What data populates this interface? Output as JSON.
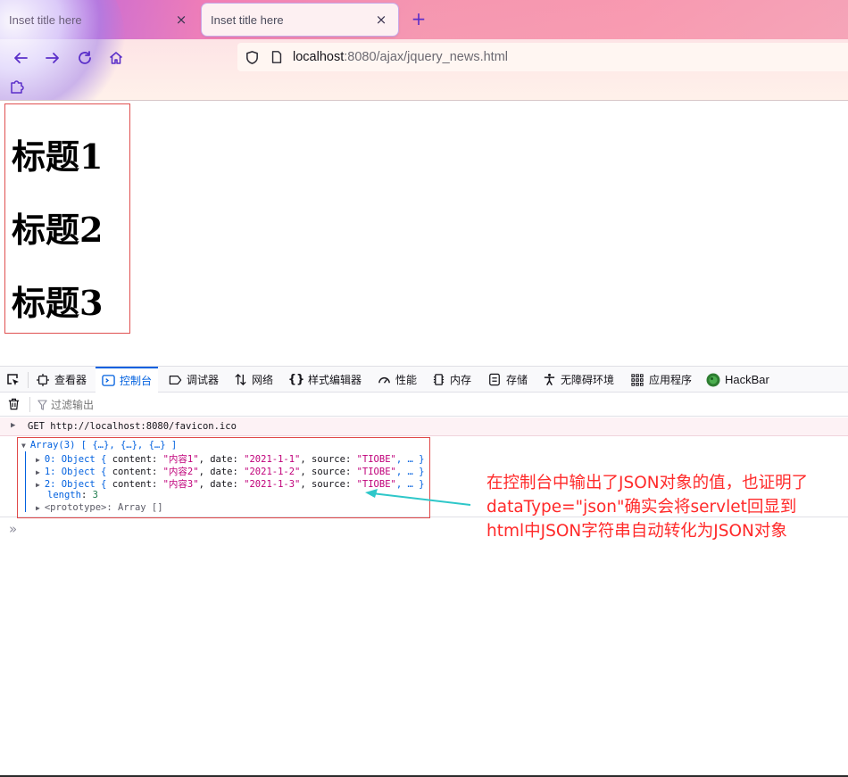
{
  "browser": {
    "tabs": [
      {
        "title": "Inset title here",
        "close_glyph": "×"
      },
      {
        "title": "Inset title here",
        "close_glyph": "×"
      }
    ],
    "new_tab_glyph": "+",
    "url_host": "localhost",
    "url_rest": ":8080/ajax/jquery_news.html",
    "accent_color": "#5b2fc9"
  },
  "page": {
    "headings": [
      "标题1",
      "标题2",
      "标题3"
    ]
  },
  "devtools": {
    "tabs": [
      {
        "label": "查看器",
        "icon": "inspector-icon"
      },
      {
        "label": "控制台",
        "icon": "console-icon"
      },
      {
        "label": "调试器",
        "icon": "debugger-icon"
      },
      {
        "label": "网络",
        "icon": "network-icon"
      },
      {
        "label": "样式编辑器",
        "icon": "style-editor-icon"
      },
      {
        "label": "性能",
        "icon": "performance-icon"
      },
      {
        "label": "内存",
        "icon": "memory-icon"
      },
      {
        "label": "存储",
        "icon": "storage-icon"
      },
      {
        "label": "无障碍环境",
        "icon": "accessibility-icon"
      },
      {
        "label": "应用程序",
        "icon": "application-icon"
      },
      {
        "label": "HackBar",
        "icon": "hackbar-icon"
      }
    ],
    "active_tab": "控制台",
    "filter_placeholder": "过滤输出",
    "network_row": "GET http://localhost:8080/favicon.ico",
    "log": {
      "array_head": "Array(3) [ {…}, {…}, {…} ]",
      "items": [
        {
          "index": "0",
          "content": "\"内容1\"",
          "date": "\"2021-1-1\"",
          "source": "\"TIOBE\""
        },
        {
          "index": "1",
          "content": "\"内容2\"",
          "date": "\"2021-1-2\"",
          "source": "\"TIOBE\""
        },
        {
          "index": "2",
          "content": "\"内容3\"",
          "date": "\"2021-1-3\"",
          "source": "\"TIOBE\""
        }
      ],
      "length_key": "length",
      "length_value": "3",
      "prototype_line": "<prototype>: Array []"
    },
    "prompt_glyph": "»"
  },
  "annotation": {
    "lines": [
      "在控制台中输出了JSON对象的值，也证明了",
      "dataType=\"json\"确实会将servlet回显到",
      "html中JSON字符串自动转化为JSON对象"
    ],
    "color": "#ff2a2a",
    "arrow_color": "#2ec7c9"
  }
}
